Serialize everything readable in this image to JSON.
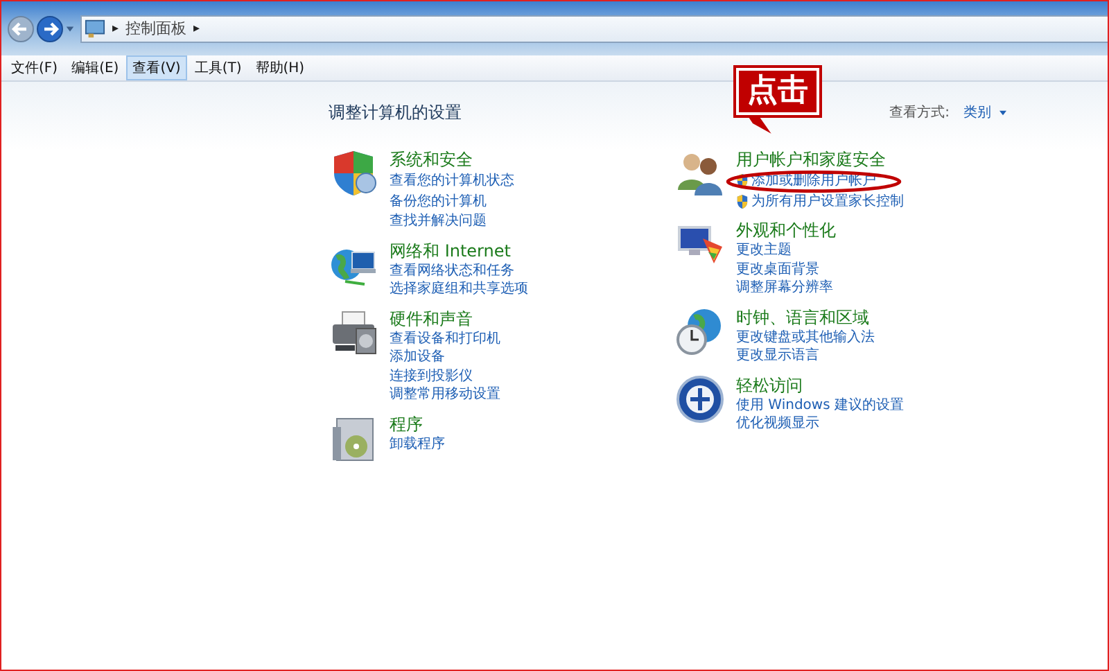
{
  "address_bar": {
    "breadcrumb": "控制面板",
    "arrow": "▸"
  },
  "menu": [
    {
      "label": "文件(F)",
      "selected": false
    },
    {
      "label": "编辑(E)",
      "selected": false
    },
    {
      "label": "查看(V)",
      "selected": true
    },
    {
      "label": "工具(T)",
      "selected": false
    },
    {
      "label": "帮助(H)",
      "selected": false
    }
  ],
  "heading": "调整计算机的设置",
  "view_by": {
    "label": "查看方式:",
    "value": "类别"
  },
  "columns": [
    [
      {
        "title": "系统和安全",
        "links": [
          {
            "text": "查看您的计算机状态"
          },
          {
            "text": "备份您的计算机"
          },
          {
            "text": "查找并解决问题"
          }
        ]
      },
      {
        "title": "网络和 Internet",
        "links": [
          {
            "text": "查看网络状态和任务"
          },
          {
            "text": "选择家庭组和共享选项"
          }
        ]
      },
      {
        "title": "硬件和声音",
        "links": [
          {
            "text": "查看设备和打印机"
          },
          {
            "text": "添加设备"
          },
          {
            "text": "连接到投影仪"
          },
          {
            "text": "调整常用移动设置"
          }
        ]
      },
      {
        "title": "程序",
        "links": [
          {
            "text": "卸载程序"
          }
        ]
      }
    ],
    [
      {
        "title": "用户帐户和家庭安全",
        "links": [
          {
            "text": "添加或删除用户帐户",
            "uac_shield": true,
            "circled": true
          },
          {
            "text": "为所有用户设置家长控制",
            "uac_shield": true,
            "circled": false
          }
        ]
      },
      {
        "title": "外观和个性化",
        "links": [
          {
            "text": "更改主题"
          },
          {
            "text": "更改桌面背景"
          },
          {
            "text": "调整屏幕分辨率"
          }
        ]
      },
      {
        "title": "时钟、语言和区域",
        "links": [
          {
            "text": "更改键盘或其他输入法"
          },
          {
            "text": "更改显示语言"
          }
        ]
      },
      {
        "title": "轻松访问",
        "links": [
          {
            "text": "使用 Windows 建议的设置"
          },
          {
            "text": "优化视频显示"
          }
        ]
      }
    ]
  ],
  "annotation": {
    "text": "点击"
  }
}
